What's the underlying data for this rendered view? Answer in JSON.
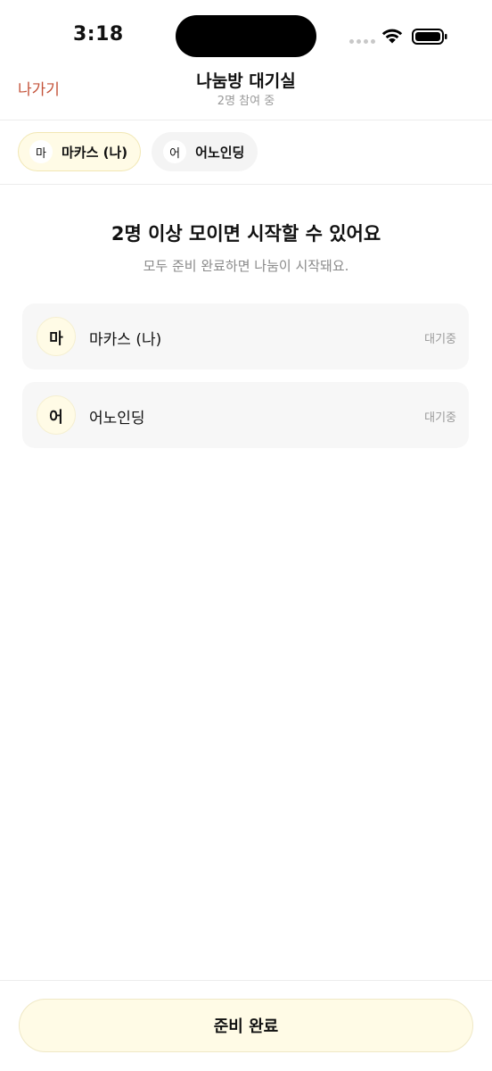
{
  "status_bar": {
    "time": "3:18",
    "icons": [
      "cellular-dots-icon",
      "wifi-icon",
      "battery-icon"
    ]
  },
  "header": {
    "leave_label": "나가기",
    "title": "나눔방 대기실",
    "subtitle": "2명 참여 중"
  },
  "chips": [
    {
      "avatar": "마",
      "label": "마카스 (나)",
      "is_me": true
    },
    {
      "avatar": "어",
      "label": "어노인딩",
      "is_me": false
    }
  ],
  "main": {
    "headline": "2명 이상 모이면 시작할 수 있어요",
    "subline": "모두 준비 완료하면 나눔이 시작돼요."
  },
  "participants": [
    {
      "avatar": "마",
      "name": "마카스 (나)",
      "status": "대기중"
    },
    {
      "avatar": "어",
      "name": "어노인딩",
      "status": "대기중"
    }
  ],
  "footer": {
    "ready_label": "준비 완료"
  },
  "colors": {
    "accent_text": "#c4533a",
    "highlight_bg": "#fffbe6",
    "card_bg": "#f7f7f7"
  }
}
